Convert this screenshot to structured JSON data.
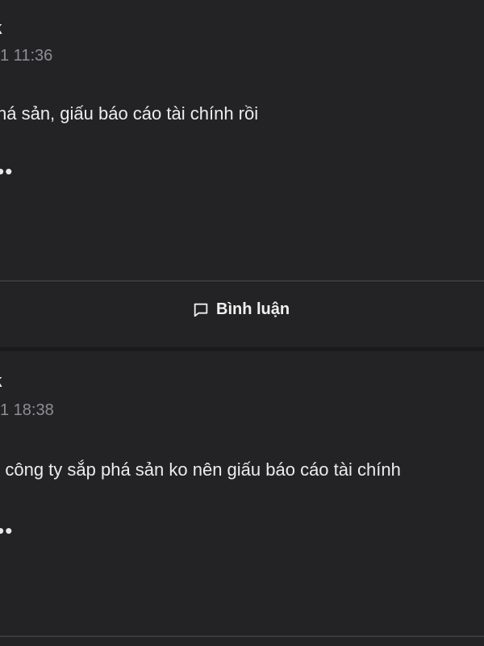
{
  "posts": [
    {
      "author": "ck",
      "time": "1 11:36",
      "content": "há sản, giấu báo cáo tài chính rồi",
      "more": "•••"
    },
    {
      "author": "ck",
      "time": "1 18:38",
      "content": "o công ty sắp phá sản ko nên giấu báo cáo tài chính",
      "more": "•••"
    }
  ],
  "actions": {
    "comment_label": "Bình luận",
    "comment_icon": "comment-icon"
  },
  "colors": {
    "background": "#1c1c1f",
    "card": "#232325",
    "divider": "#3a3a3d",
    "muted_text": "#8e8e93",
    "text": "#ececec"
  }
}
